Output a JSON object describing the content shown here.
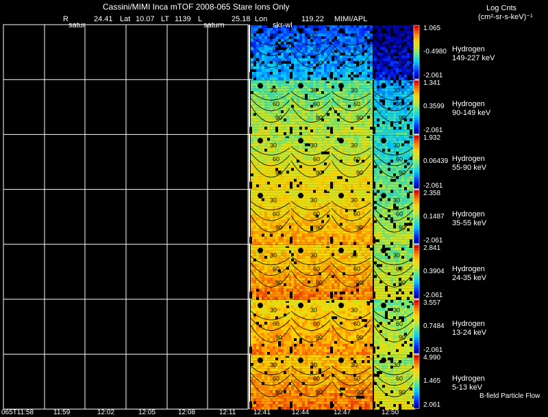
{
  "header": {
    "title": "Cassini/MIMI Inca mTOF  2008-065   Stare   Ions Only",
    "r_label": "R",
    "r_value": "24.41",
    "lat_label": "Lat",
    "lat_value": "10.07",
    "lt_label": "LT",
    "lt_value": "1139",
    "l_label": "L",
    "l_value": "25.18",
    "lon_label": "Lon",
    "lon_value": "119.22",
    "credit": "MIMI/APL",
    "units_line1": "Log Cnts",
    "units_line2": "(cm²-sr-s-keV)⁻¹",
    "marker_saturn_1": "satur",
    "marker_saturn_2": "saturn",
    "marker_skr": "skr-wl"
  },
  "channels": [
    {
      "species": "Hydrogen",
      "energy": "149-227 keV",
      "cb_max": "1.065",
      "cb_mid": "-0.4980",
      "cb_min": "-2.061",
      "level": 0.15
    },
    {
      "species": "Hydrogen",
      "energy": "90-149 keV",
      "cb_max": "1.341",
      "cb_mid": "0.3599",
      "cb_min": "-2.061",
      "level": 0.45
    },
    {
      "species": "Hydrogen",
      "energy": "55-90 keV",
      "cb_max": "1.932",
      "cb_mid": "0.06439",
      "cb_min": "-2.061",
      "level": 0.55
    },
    {
      "species": "Hydrogen",
      "energy": "35-55 keV",
      "cb_max": "2.358",
      "cb_mid": "0.1487",
      "cb_min": "-2.061",
      "level": 0.65
    },
    {
      "species": "Hydrogen",
      "energy": "24-35 keV",
      "cb_max": "2.841",
      "cb_mid": "0.3904",
      "cb_min": "-2.061",
      "level": 0.7
    },
    {
      "species": "Hydrogen",
      "energy": "13-24 keV",
      "cb_max": "3.557",
      "cb_mid": "0.7484",
      "cb_min": "-2.061",
      "level": 0.68
    },
    {
      "species": "Hydrogen",
      "energy": "5-13 keV",
      "cb_max": "4.990",
      "cb_mid": "1.465",
      "cb_min": "2.061",
      "level": 0.72
    }
  ],
  "contour_labels": [
    "30",
    "60",
    "90"
  ],
  "time_ticks": [
    "065T11:58",
    "11:59",
    "12:02",
    "12:05",
    "12:08",
    "12:11",
    "12:41",
    "12:44",
    "12:47",
    "12:50"
  ],
  "footer_note": "B-field Particle Flow"
}
